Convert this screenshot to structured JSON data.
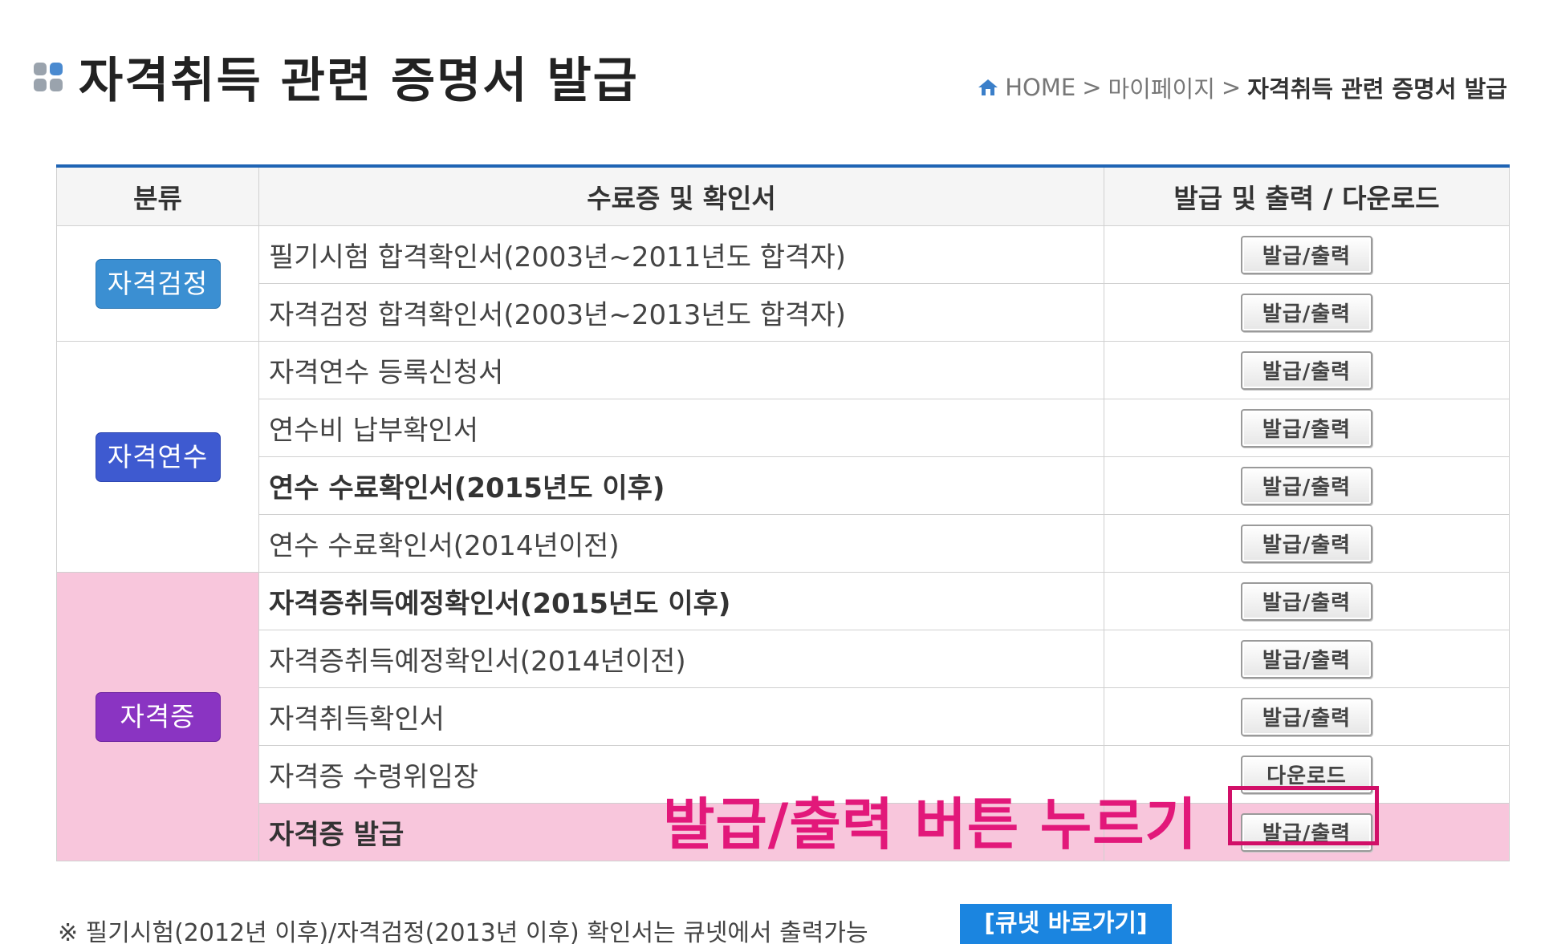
{
  "page": {
    "title": "자격취득 관련 증명서 발급",
    "breadcrumb": {
      "home": "HOME",
      "separator": ">",
      "parent": "마이페이지",
      "current": "자격취득 관련 증명서 발급"
    }
  },
  "table": {
    "headers": [
      "분류",
      "수료증 및 확인서",
      "발급 및 출력 / 다운로드"
    ],
    "groups": [
      {
        "category": "자격검정",
        "color": "#3b8fd2",
        "rows": [
          {
            "doc": "필기시험 합격확인서(2003년~2011년도 합격자)",
            "action": "발급/출력"
          },
          {
            "doc": "자격검정 합격확인서(2003년~2013년도 합격자)",
            "action": "발급/출력"
          }
        ]
      },
      {
        "category": "자격연수",
        "color": "#3e5ad0",
        "rows": [
          {
            "doc": "자격연수 등록신청서",
            "action": "발급/출력"
          },
          {
            "doc": "연수비 납부확인서",
            "action": "발급/출력"
          },
          {
            "doc": "연수 수료확인서(2015년도 이후)",
            "action": "발급/출력"
          },
          {
            "doc": "연수 수료확인서(2014년이전)",
            "action": "발급/출력"
          }
        ]
      },
      {
        "category": "자격증",
        "color": "#8a34c2",
        "rows": [
          {
            "doc": "자격증취득예정확인서(2015년도 이후)",
            "action": "발급/출력"
          },
          {
            "doc": "자격증취득예정확인서(2014년이전)",
            "action": "발급/출력"
          },
          {
            "doc": "자격취득확인서",
            "action": "발급/출력"
          },
          {
            "doc": "자격증 수령위임장",
            "action": "다운로드"
          },
          {
            "doc": "자격증 발급",
            "action": "발급/출력"
          }
        ]
      }
    ]
  },
  "annotation": {
    "text": "발급/출력 버튼 누르기",
    "color": "#e2187a"
  },
  "note": {
    "text": "※ 필기시험(2012년 이후)/자격검정(2013년 이후) 확인서는 큐넷에서 출력가능",
    "link_label": "[큐넷 바로가기]"
  },
  "icons": {
    "title": "grid-squares-icon",
    "breadcrumb_home": "home-icon"
  }
}
